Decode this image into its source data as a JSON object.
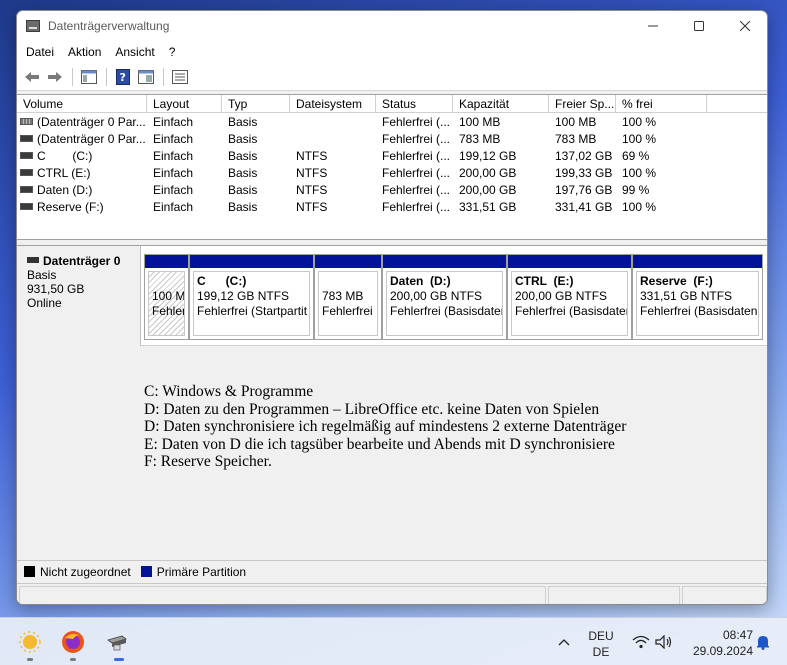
{
  "window": {
    "title": "Datenträgerverwaltung",
    "minimize_icon": "minimize-icon",
    "maximize_icon": "maximize-icon",
    "close_icon": "close-icon"
  },
  "menu": {
    "items": [
      "Datei",
      "Aktion",
      "Ansicht",
      "?"
    ]
  },
  "toolbar": {
    "icons": [
      "back-arrow-icon",
      "forward-arrow-icon",
      "console-tree-icon",
      "help-icon",
      "properties-icon",
      "list-view-icon"
    ]
  },
  "list": {
    "columns": [
      "Volume",
      "Layout",
      "Typ",
      "Dateisystem",
      "Status",
      "Kapazität",
      "Freier Sp...",
      "% frei"
    ],
    "rows": [
      {
        "volume": "(Datenträger 0 Par...",
        "layout": "Einfach",
        "typ": "Basis",
        "fs": "",
        "status": "Fehlerfrei (...",
        "cap": "100 MB",
        "free": "100 MB",
        "pct": "100 %"
      },
      {
        "volume": "(Datenträger 0 Par...",
        "layout": "Einfach",
        "typ": "Basis",
        "fs": "",
        "status": "Fehlerfrei (...",
        "cap": "783 MB",
        "free": "783 MB",
        "pct": "100 %"
      },
      {
        "volume": "C        (C:)",
        "layout": "Einfach",
        "typ": "Basis",
        "fs": "NTFS",
        "status": "Fehlerfrei (...",
        "cap": "199,12 GB",
        "free": "137,02 GB",
        "pct": "69 %"
      },
      {
        "volume": "CTRL (E:)",
        "layout": "Einfach",
        "typ": "Basis",
        "fs": "NTFS",
        "status": "Fehlerfrei (...",
        "cap": "200,00 GB",
        "free": "199,33 GB",
        "pct": "100 %"
      },
      {
        "volume": "Daten (D:)",
        "layout": "Einfach",
        "typ": "Basis",
        "fs": "NTFS",
        "status": "Fehlerfrei (...",
        "cap": "200,00 GB",
        "free": "197,76 GB",
        "pct": "99 %"
      },
      {
        "volume": "Reserve (F:)",
        "layout": "Einfach",
        "typ": "Basis",
        "fs": "NTFS",
        "status": "Fehlerfrei (...",
        "cap": "331,51 GB",
        "free": "331,41 GB",
        "pct": "100 %"
      }
    ]
  },
  "disk": {
    "title": "Datenträger 0",
    "type": "Basis",
    "size": "931,50 GB",
    "state": "Online",
    "partitions": [
      {
        "name": "",
        "line1": "100 M",
        "line2": "Fehler",
        "hatched": true
      },
      {
        "name": "C      (C:)",
        "line1": "199,12 GB NTFS",
        "line2": "Fehlerfrei (Startpartit",
        "hatched": false
      },
      {
        "name": "",
        "line1": "783 MB",
        "line2": "Fehlerfrei",
        "hatched": false
      },
      {
        "name": "Daten  (D:)",
        "line1": "200,00 GB NTFS",
        "line2": "Fehlerfrei (Basisdater",
        "hatched": false
      },
      {
        "name": "CTRL  (E:)",
        "line1": "200,00 GB NTFS",
        "line2": "Fehlerfrei (Basisdater",
        "hatched": false
      },
      {
        "name": "Reserve  (F:)",
        "line1": "331,51 GB NTFS",
        "line2": "Fehlerfrei (Basisdatenp",
        "hatched": false
      }
    ]
  },
  "notes": [
    "C: Windows & Programme",
    "D: Daten zu den Programmen – LibreOffice etc. keine Daten von Spielen",
    "D: Daten synchronisiere ich regelmäßig auf mindestens 2 externe Datenträger",
    "E: Daten von D die ich tagsüber bearbeite und Abends mit D synchronisiere",
    "F: Reserve Speicher."
  ],
  "legend": {
    "unallocated": "Nicht zugeordnet",
    "unallocated_color": "#000000",
    "primary": "Primäre Partition",
    "primary_color": "#02139a"
  },
  "taskbar": {
    "apps": [
      "weather-icon",
      "firefox-icon",
      "disk-management-icon"
    ],
    "chevron_icon": "chevron-up-icon",
    "lang_top": "DEU",
    "lang_bottom": "DE",
    "network_icon": "wifi-icon",
    "volume_icon": "speaker-icon",
    "time": "08:47",
    "date": "29.09.2024",
    "notification_icon": "bell-icon"
  }
}
